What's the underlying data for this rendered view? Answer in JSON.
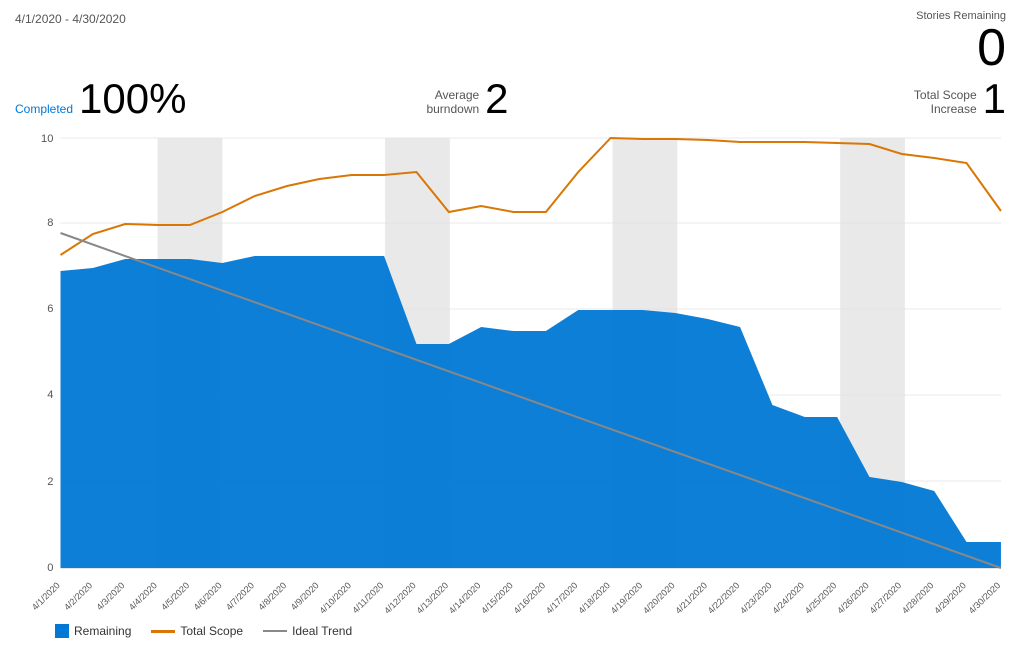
{
  "header": {
    "date_range": "4/1/2020 - 4/30/2020",
    "stories_remaining_label": "Stories Remaining",
    "stories_remaining_value": "0"
  },
  "metrics": {
    "completed_label": "Completed",
    "completed_value": "100%",
    "avg_burndown_label1": "Average",
    "avg_burndown_label2": "burndown",
    "avg_burndown_value": "2",
    "total_scope_label1": "Total Scope",
    "total_scope_label2": "Increase",
    "total_scope_value": "1"
  },
  "legend": {
    "remaining_label": "Remaining",
    "total_scope_label": "Total Scope",
    "ideal_trend_label": "Ideal Trend"
  },
  "chart": {
    "y_labels": [
      "0",
      "2",
      "4",
      "6",
      "8",
      "10"
    ],
    "x_labels": [
      "4/1/2020",
      "4/2/2020",
      "4/3/2020",
      "4/4/2020",
      "4/5/2020",
      "4/6/2020",
      "4/7/2020",
      "4/8/2020",
      "4/9/2020",
      "4/10/2020",
      "4/11/2020",
      "4/12/2020",
      "4/13/2020",
      "4/14/2020",
      "4/15/2020",
      "4/16/2020",
      "4/17/2020",
      "4/18/2020",
      "4/19/2020",
      "4/20/2020",
      "4/21/2020",
      "4/22/2020",
      "4/23/2020",
      "4/24/2020",
      "4/25/2020",
      "4/26/2020",
      "4/27/2020",
      "4/28/2020",
      "4/29/2020",
      "4/30/2020"
    ],
    "colors": {
      "remaining": "#0078d4",
      "total_scope": "#d97706",
      "ideal_trend": "#888888",
      "weekend": "#e0e0e0"
    }
  }
}
